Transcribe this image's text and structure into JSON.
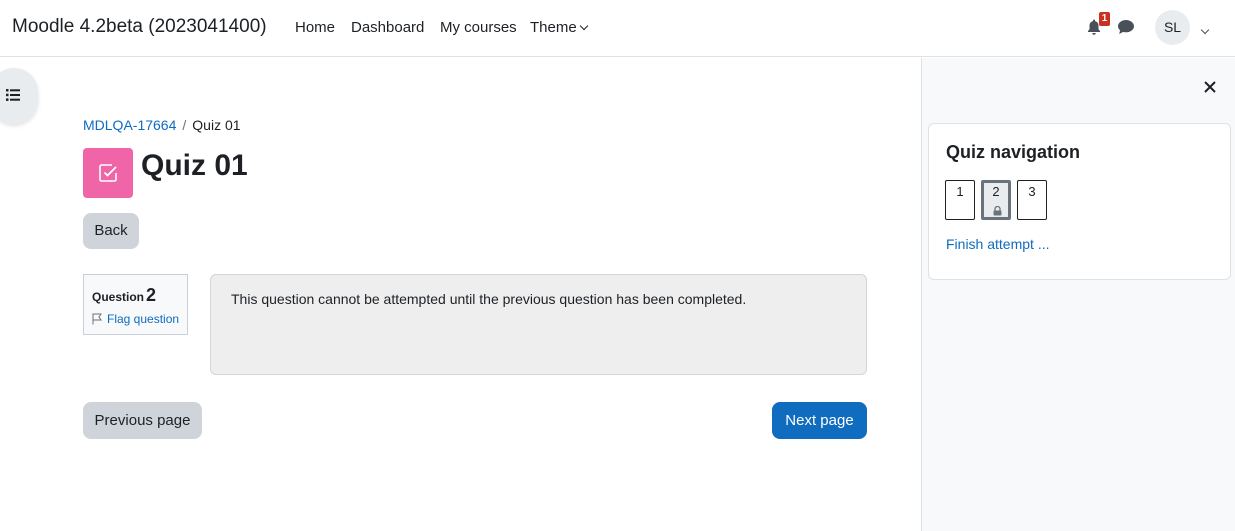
{
  "navbar": {
    "brand": "Moodle 4.2beta (2023041400)",
    "items": [
      "Home",
      "Dashboard",
      "My courses",
      "Theme"
    ],
    "notification_count": "1",
    "user_initials": "SL"
  },
  "breadcrumb": {
    "course": "MDLQA-17664",
    "separator": "/",
    "current": "Quiz 01"
  },
  "page": {
    "title": "Quiz 01",
    "back_label": "Back"
  },
  "question": {
    "label": "Question",
    "number": "2",
    "flag_label": "Flag question",
    "text": "This question cannot be attempted until the previous question has been completed."
  },
  "nav_buttons": {
    "previous": "Previous page",
    "next": "Next page"
  },
  "quiz_navigation": {
    "title": "Quiz navigation",
    "questions": [
      "1",
      "2",
      "3"
    ],
    "current": "2",
    "finish_label": "Finish attempt ..."
  },
  "colors": {
    "primary": "#0f6cbf",
    "quiz_icon": "#f065a8",
    "badge": "#ca3120"
  }
}
